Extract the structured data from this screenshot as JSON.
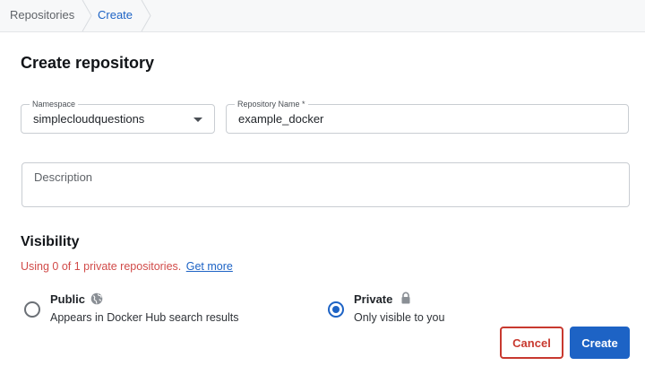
{
  "breadcrumb": {
    "items": [
      "Repositories",
      "Create"
    ]
  },
  "page": {
    "title": "Create repository"
  },
  "form": {
    "namespace": {
      "label": "Namespace",
      "value": "simplecloudquestions"
    },
    "repository_name": {
      "label": "Repository Name *",
      "value": "example_docker"
    },
    "description": {
      "placeholder": "Description",
      "value": ""
    }
  },
  "visibility": {
    "title": "Visibility",
    "usage_text": "Using 0 of 1 private repositories.",
    "usage_link": "Get more",
    "options": [
      {
        "title": "Public",
        "description": "Appears in Docker Hub search results",
        "icon": "globe-icon",
        "selected": false
      },
      {
        "title": "Private",
        "description": "Only visible to you",
        "icon": "lock-icon",
        "selected": true
      }
    ]
  },
  "actions": {
    "cancel_label": "Cancel",
    "create_label": "Create"
  },
  "colors": {
    "accent": "#1d63c5",
    "danger": "#c8392f",
    "warning_text": "#d14b49"
  }
}
